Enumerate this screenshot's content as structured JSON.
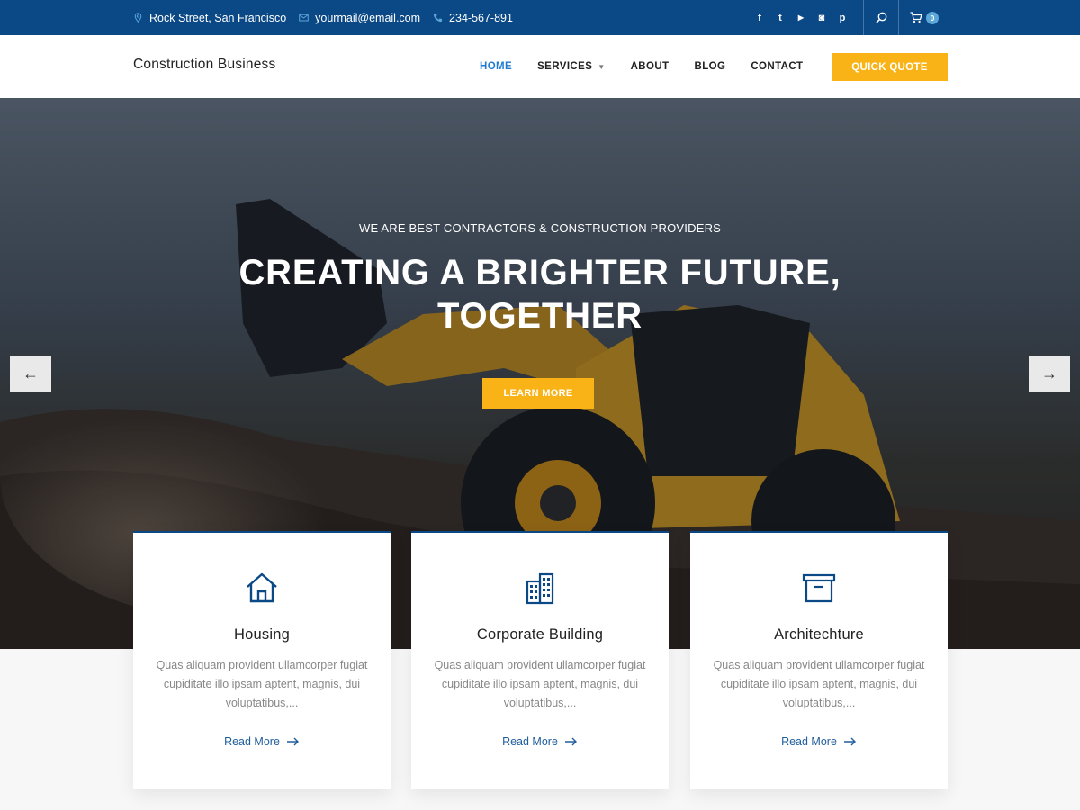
{
  "topbar": {
    "address": "Rock Street, San Francisco",
    "email": "yourmail@email.com",
    "phone": "234-567-891",
    "social": [
      {
        "icon": "facebook-icon",
        "glyph": "f"
      },
      {
        "icon": "twitter-icon",
        "glyph": "t"
      },
      {
        "icon": "youtube-icon",
        "glyph": "▶"
      },
      {
        "icon": "instagram-icon",
        "glyph": "◙"
      },
      {
        "icon": "pinterest-icon",
        "glyph": "p"
      }
    ],
    "cart_count": "0"
  },
  "header": {
    "logo": "Construction Business",
    "nav": [
      {
        "label": "HOME",
        "active": true
      },
      {
        "label": "SERVICES",
        "active": false,
        "dropdown": true
      },
      {
        "label": "ABOUT",
        "active": false
      },
      {
        "label": "BLOG",
        "active": false
      },
      {
        "label": "CONTACT",
        "active": false
      }
    ],
    "quote_label": "QUICK QUOTE"
  },
  "hero": {
    "subtitle": "WE ARE BEST CONTRACTORS &  CONSTRUCTION PROVIDERS",
    "title_line1": "CREATING A BRIGHTER FUTURE,",
    "title_line2": "TOGETHER",
    "button_label": "LEARN MORE",
    "prev_arrow": "←",
    "next_arrow": "→"
  },
  "cards": [
    {
      "icon": "house-icon",
      "title": "Housing",
      "desc": "Quas aliquam provident ullamcorper fugiat cupiditate illo ipsam aptent, magnis, dui voluptatibus,...",
      "more": "Read More"
    },
    {
      "icon": "building-icon",
      "title": "Corporate Building",
      "desc": "Quas aliquam provident ullamcorper fugiat cupiditate illo ipsam aptent, magnis, dui voluptatibus,...",
      "more": "Read More"
    },
    {
      "icon": "archive-box-icon",
      "title": "Architechture",
      "desc": "Quas aliquam provident ullamcorper fugiat cupiditate illo ipsam aptent, magnis, dui voluptatibus,...",
      "more": "Read More"
    }
  ],
  "colors": {
    "primary": "#0b4886",
    "accent": "#f9b316",
    "link": "#1f7bd0"
  }
}
